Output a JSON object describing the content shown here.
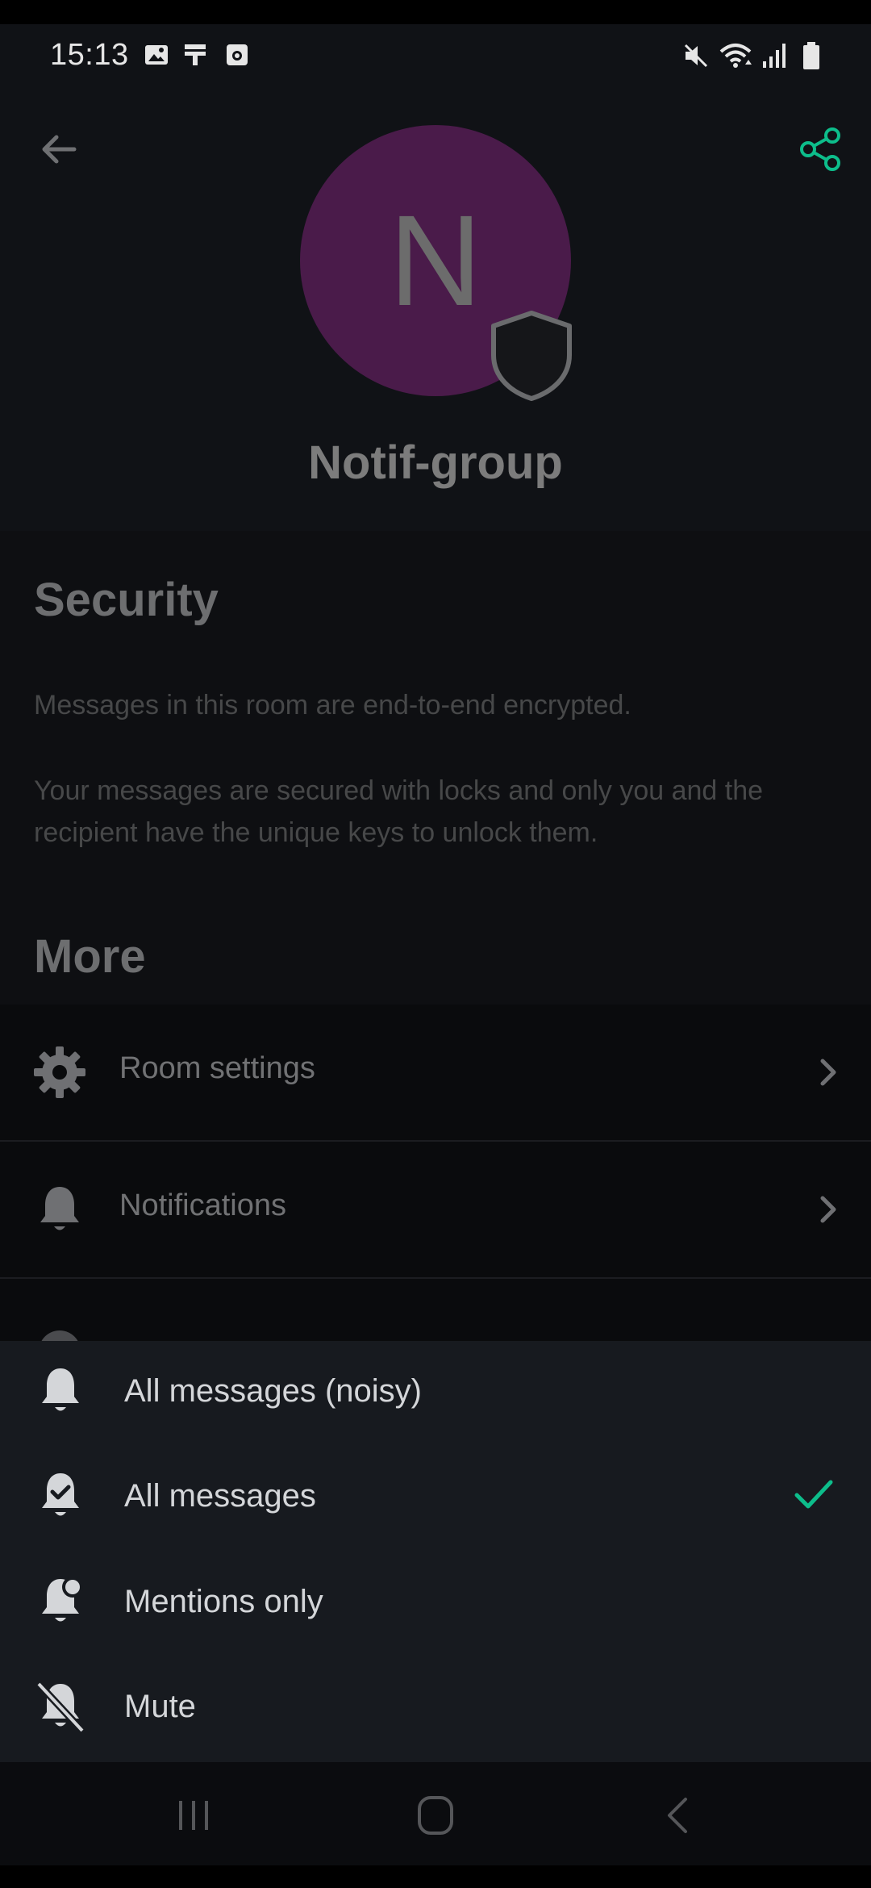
{
  "status_bar": {
    "time": "15:13",
    "left_icons": [
      "gallery-icon",
      "download-icon",
      "box-icon"
    ],
    "right_icons": [
      "mute-icon",
      "wifi-icon",
      "signal-icon",
      "battery-icon"
    ]
  },
  "header": {
    "avatar_letter": "N",
    "avatar_color": "#4a1b4a",
    "room_name": "Notif-group",
    "accent_color": "#0dbd8b"
  },
  "security": {
    "title": "Security",
    "text1": "Messages in this room are end-to-end encrypted.",
    "text2_line1": "Your messages are secured with locks and only you and the",
    "text2_line2": "recipient have the unique keys to unlock them."
  },
  "more": {
    "title": "More",
    "items": [
      {
        "label": "Room settings",
        "icon": "gear-icon"
      },
      {
        "label": "Notifications",
        "icon": "bell-icon"
      }
    ]
  },
  "notification_sheet": {
    "options": [
      {
        "label": "All messages (noisy)",
        "icon": "bell-icon",
        "selected": false
      },
      {
        "label": "All messages",
        "icon": "bell-check-icon",
        "selected": true
      },
      {
        "label": "Mentions only",
        "icon": "bell-dot-icon",
        "selected": false
      },
      {
        "label": "Mute",
        "icon": "bell-off-icon",
        "selected": false
      }
    ]
  },
  "nav_bar": [
    "recents-icon",
    "home-icon",
    "back-icon"
  ]
}
